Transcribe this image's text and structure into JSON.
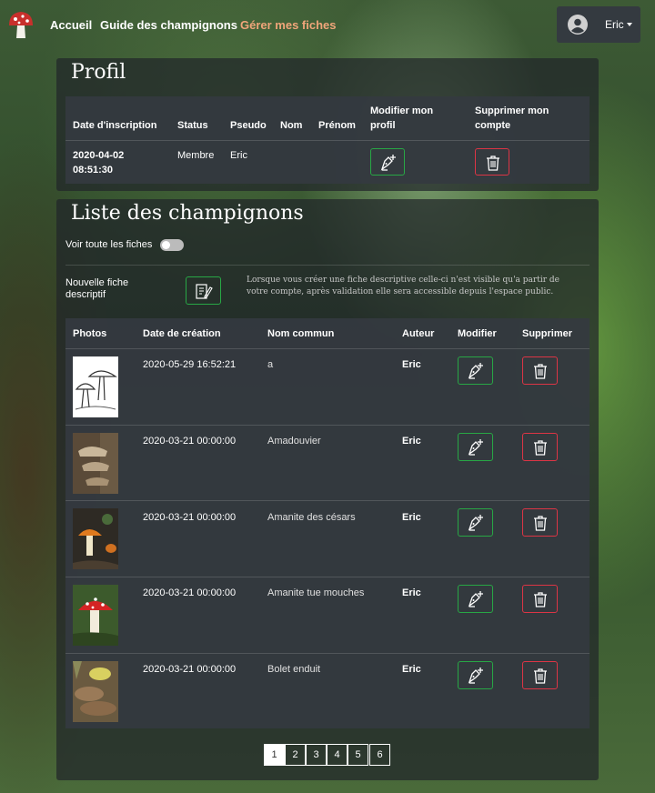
{
  "nav": {
    "links": [
      "Accueil",
      "Guide des champignons",
      "Gérer mes fiches"
    ],
    "user": "Eric"
  },
  "profile": {
    "title": "Profil",
    "headers": [
      "Date d'inscription",
      "Status",
      "Pseudo",
      "Nom",
      "Prénom",
      "Modifier mon profil",
      "Supprimer mon compte"
    ],
    "row": {
      "date_line1": "2020-04-02",
      "date_line2": "08:51:30",
      "status": "Membre",
      "pseudo": "Eric",
      "nom": "",
      "prenom": ""
    }
  },
  "list": {
    "title": "Liste des champignons",
    "toggle_label": "Voir toute les fiches",
    "new_label": "Nouvelle fiche descriptif",
    "info": "Lorsque vous créer une fiche descriptive celle-ci n'est visible qu'a partir de votre compte, après validation elle sera accessible depuis l'espace public.",
    "headers": [
      "Photos",
      "Date de création",
      "Nom commun",
      "Auteur",
      "Modifier",
      "Supprimer"
    ],
    "rows": [
      {
        "date": "2020-05-29 16:52:21",
        "name": "a",
        "author": "Eric",
        "photo": "sketch-mushroom"
      },
      {
        "date": "2020-03-21 00:00:00",
        "name": "Amadouvier",
        "author": "Eric",
        "photo": "bracket-fungus"
      },
      {
        "date": "2020-03-21 00:00:00",
        "name": "Amanite des césars",
        "author": "Eric",
        "photo": "orange-cap"
      },
      {
        "date": "2020-03-21 00:00:00",
        "name": "Amanite tue mouches",
        "author": "Eric",
        "photo": "fly-agaric"
      },
      {
        "date": "2020-03-21 00:00:00",
        "name": "Bolet enduit",
        "author": "Eric",
        "photo": "slippery-jack"
      }
    ]
  },
  "pagination": {
    "pages": [
      "1",
      "2",
      "3",
      "4",
      "5",
      "6"
    ],
    "active": "1"
  }
}
